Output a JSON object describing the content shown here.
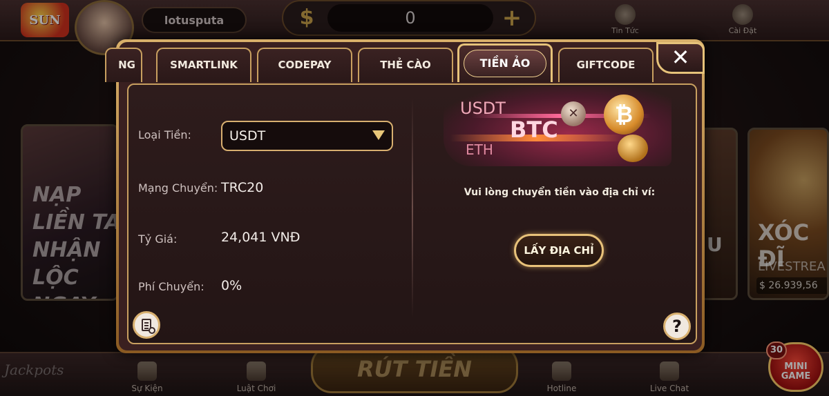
{
  "topbar": {
    "username": "lotusputa",
    "balance": "0",
    "news_label": "Tin Tức",
    "settings_label": "Cài Đặt"
  },
  "background": {
    "promo_card_text": "NẠP LIỀN TAY NHẬN LỘC NGAY",
    "game_card_title": "XÓC ĐĨ",
    "game_card_subtitle": "LIVESTREA",
    "game_card_amount": "$ 26.939,56"
  },
  "bottombar": {
    "events_label": "Sự Kiện",
    "rules_label": "Luật Chơi",
    "withdraw_label": "RÚT TIỀN",
    "hotline_label": "Hotline",
    "livechat_label": "Live Chat",
    "jackpots_label": "Jackpots",
    "minigame_label": "MINI GAME",
    "minigame_badge": "30"
  },
  "modal": {
    "tabs": [
      {
        "label": "NG"
      },
      {
        "label": "SMARTLINK"
      },
      {
        "label": "CODEPAY"
      },
      {
        "label": "THẺ CÀO"
      },
      {
        "label": "TIỀN ẢO"
      },
      {
        "label": "GIFTCODE"
      }
    ],
    "active_tab": "TIỀN ẢO",
    "close_label": "✕",
    "fields": {
      "currency_label": "Loại Tiền:",
      "currency_value": "USDT",
      "network_label": "Mạng Chuyển:",
      "network_value": "TRC20",
      "rate_label": "Tỷ Giá:",
      "rate_value": "24,041 VNĐ",
      "fee_label": "Phí Chuyển:",
      "fee_value": "0%"
    },
    "banner": {
      "usdt": "USDT",
      "btc": "BTC",
      "eth": "ETH",
      "btc_symbol": "₿"
    },
    "instruction": "Vui lòng chuyển tiền vào địa chỉ ví:",
    "get_address_button": "LẤY ĐỊA CHỈ",
    "help_label": "?"
  },
  "colors": {
    "accent_gold": "#e6c27a",
    "panel_bg": "#2e1c1c"
  }
}
